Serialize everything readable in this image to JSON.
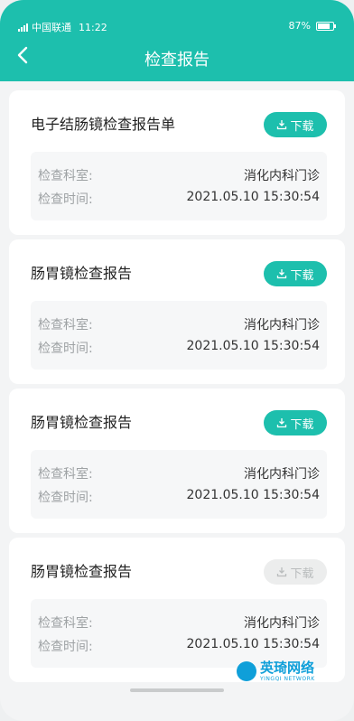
{
  "status_bar": {
    "carrier": "中国联通",
    "time": "11:22",
    "battery": "87%"
  },
  "nav": {
    "title": "检查报告",
    "back_icon": "chevron-left-icon"
  },
  "reports": [
    {
      "title": "电子结肠镜检查报告单",
      "download_label": "下载",
      "download_enabled": true,
      "dept_label": "检查科室:",
      "dept_value": "消化内科门诊",
      "time_label": "检查时间:",
      "time_value": "2021.05.10  15:30:54"
    },
    {
      "title": "肠胃镜检查报告",
      "download_label": "下载",
      "download_enabled": true,
      "dept_label": "检查科室:",
      "dept_value": "消化内科门诊",
      "time_label": "检查时间:",
      "time_value": "2021.05.10  15:30:54"
    },
    {
      "title": "肠胃镜检查报告",
      "download_label": "下载",
      "download_enabled": true,
      "dept_label": "检查科室:",
      "dept_value": "消化内科门诊",
      "time_label": "检查时间:",
      "time_value": "2021.05.10  15:30:54"
    },
    {
      "title": "肠胃镜检查报告",
      "download_label": "下载",
      "download_enabled": false,
      "dept_label": "检查科室:",
      "dept_value": "消化内科门诊",
      "time_label": "检查时间:",
      "time_value": "2021.05.10  15:30:54"
    }
  ],
  "watermark": {
    "main": "英琦网络",
    "sub": "YINGQI NETWORK"
  },
  "colors": {
    "accent": "#1dbfad",
    "disabled_button": "#eceded",
    "background": "#f3f4f5"
  }
}
